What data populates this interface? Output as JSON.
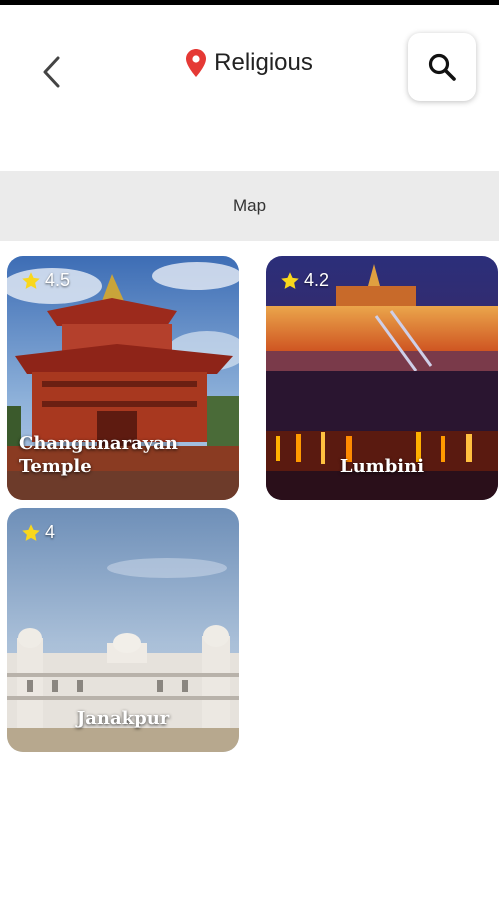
{
  "header": {
    "title": "Religious",
    "back_icon": "chevron-left-icon",
    "location_icon": "map-pin-icon",
    "search_icon": "search-icon",
    "pin_color": "#e53935"
  },
  "map_bar": {
    "label": "Map"
  },
  "places": [
    {
      "name": "Changunarayan Temple",
      "rating": "4.5"
    },
    {
      "name": "Lumbini",
      "rating": "4.2"
    },
    {
      "name": "Janakpur",
      "rating": "4"
    }
  ],
  "colors": {
    "star": "#f9d71c",
    "map_bar_bg": "#ebebeb"
  }
}
